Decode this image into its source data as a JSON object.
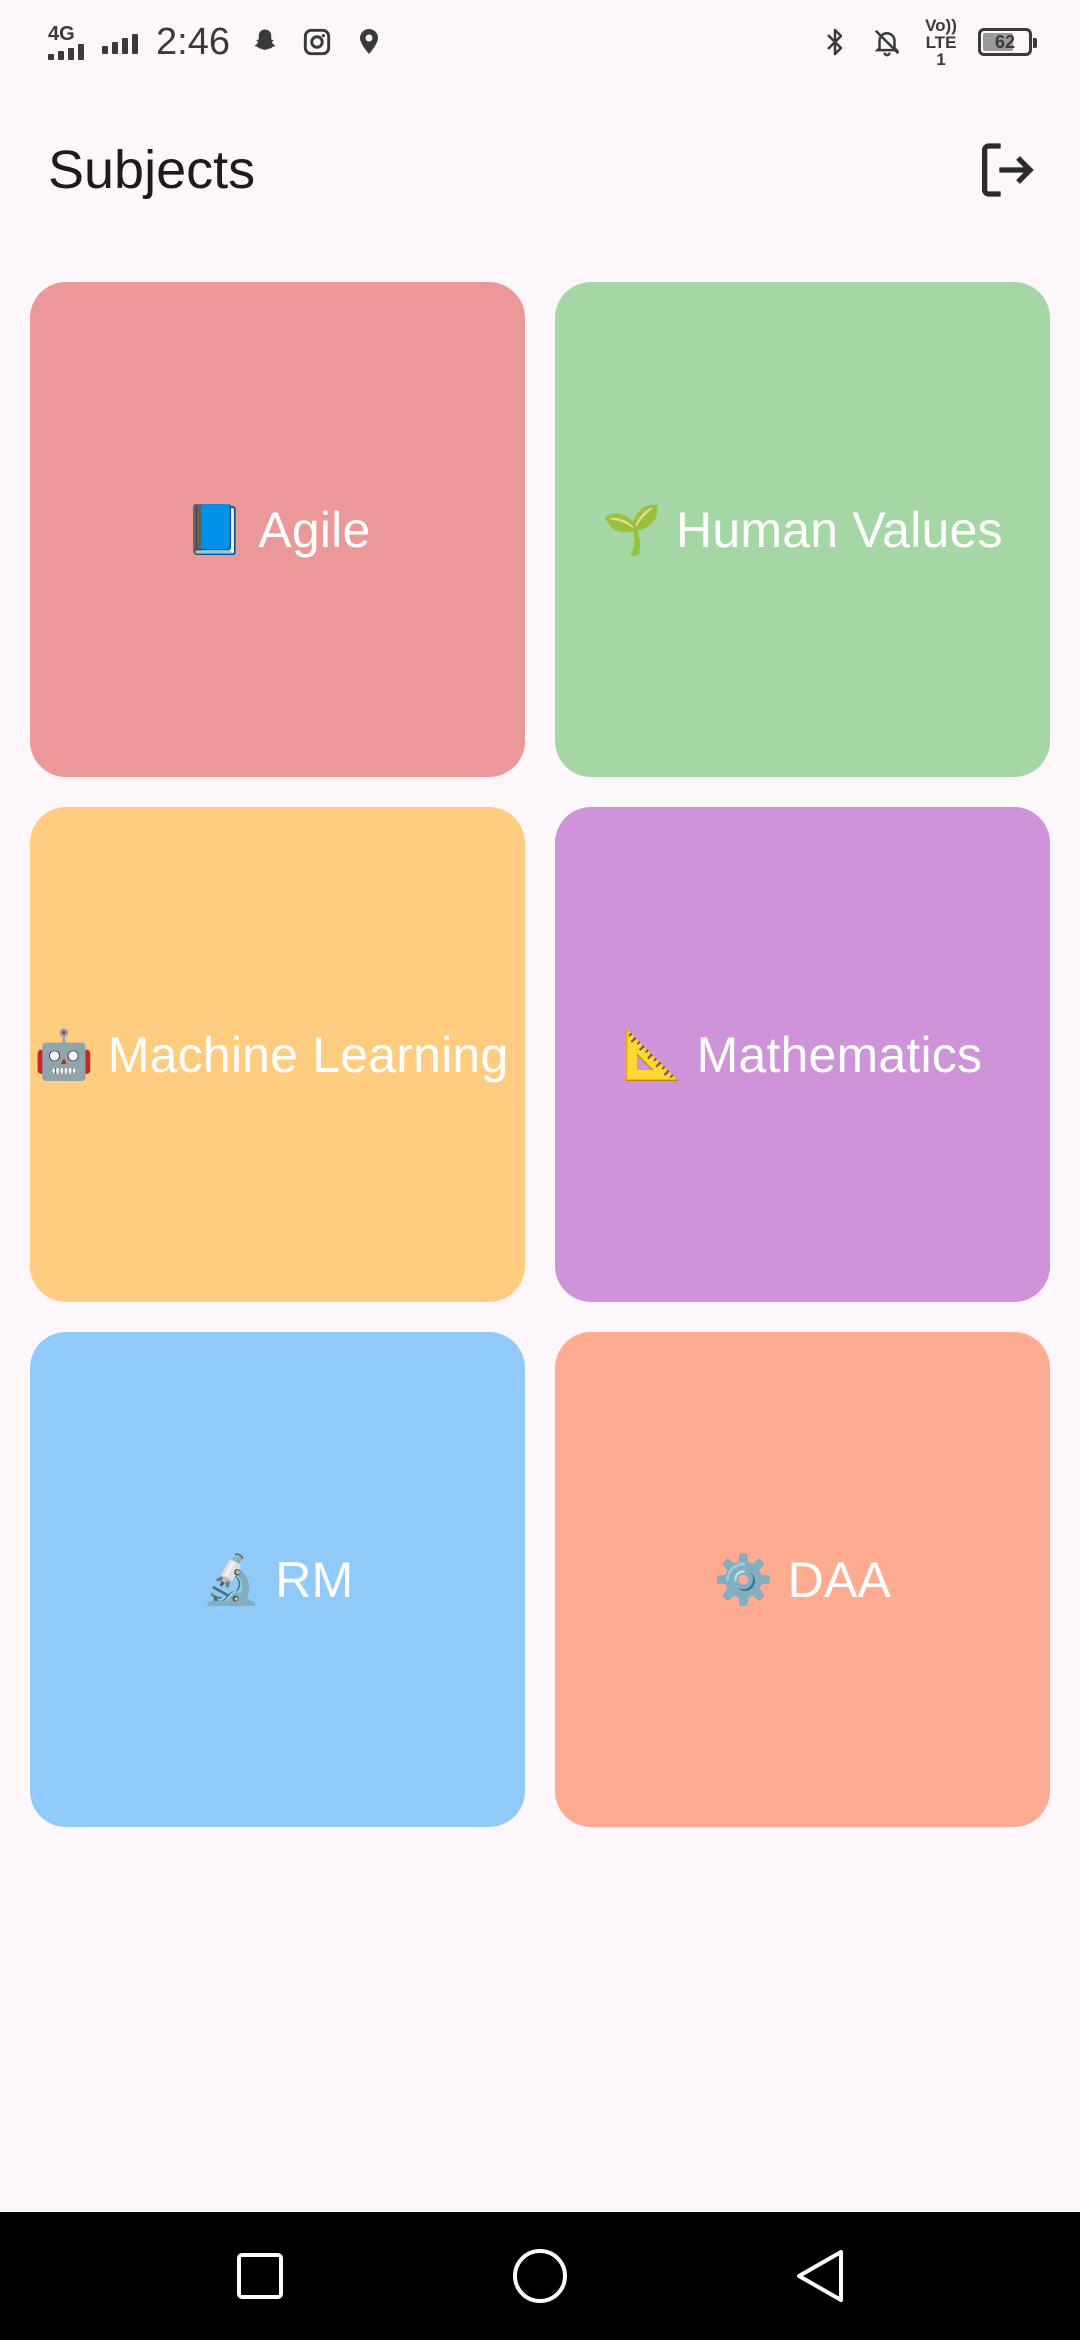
{
  "status_bar": {
    "network": "4G",
    "time": "2:46",
    "volte": "Vo)) LTE1",
    "battery": "62",
    "battery_level": 0.62,
    "icons": [
      "signal-icon",
      "snapchat-icon",
      "instagram-icon",
      "location-icon",
      "bluetooth-icon",
      "bell-off-icon",
      "volte-icon",
      "battery-icon"
    ]
  },
  "app_bar": {
    "title": "Subjects",
    "logout_icon": "logout-icon"
  },
  "subjects": [
    {
      "emoji": "📘",
      "name": "Agile",
      "color": "#ec9898"
    },
    {
      "emoji": "🌱",
      "name": "Human Values",
      "color": "#a5d6a6"
    },
    {
      "emoji": "🤖",
      "name": "Machine Learning",
      "color": "#ffcc80"
    },
    {
      "emoji": "📐",
      "name": "Mathematics",
      "color": "#ce93d8"
    },
    {
      "emoji": "🔬",
      "name": "RM",
      "color": "#90caf8"
    },
    {
      "emoji": "⚙️",
      "name": "DAA",
      "color": "#ffab91"
    }
  ],
  "nav_bar": {
    "icons": [
      "recents-icon",
      "home-icon",
      "back-icon"
    ]
  },
  "colors": {
    "background": "#fdf7fc",
    "nav_bar": "#000000"
  }
}
